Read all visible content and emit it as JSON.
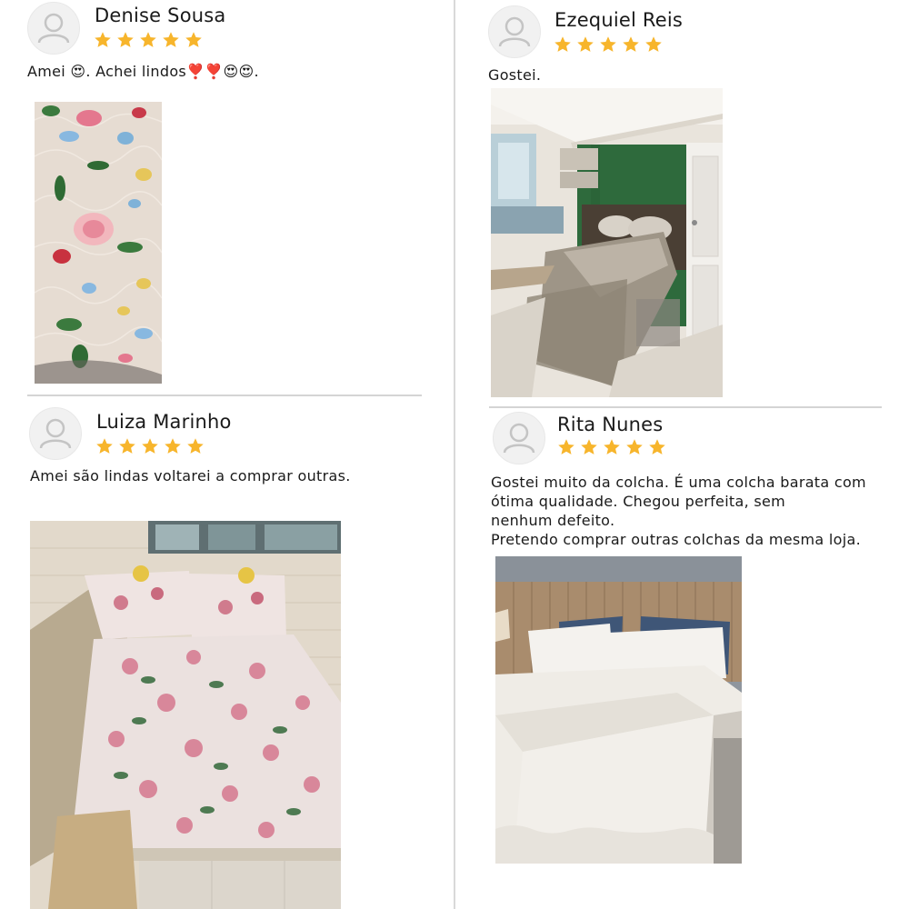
{
  "reviews": [
    {
      "name": "Denise Sousa",
      "rating": 5,
      "text": "Amei 😍. Achei lindos❣️❣️😍😍.",
      "photo": "floral-quilt-closeup-photo"
    },
    {
      "name": "Ezequiel Reis",
      "rating": 5,
      "text": "Gostei.",
      "photo": "bedroom-green-wall-photo"
    },
    {
      "name": "Luiza Marinho",
      "rating": 5,
      "text": "Amei são lindas voltarei a comprar outras.",
      "photo": "floral-bedspread-photo"
    },
    {
      "name": "Rita Nunes",
      "rating": 5,
      "text": "Gostei muito da colcha. É uma colcha barata com\nótima qualidade. Chegou perfeita, sem\nnenhum defeito.\nPretendo comprar outras colchas da mesma loja.",
      "photo": "white-bedspread-photo"
    }
  ],
  "colors": {
    "star": "#f7b52c",
    "divider": "#d4d4d4",
    "avatar_bg": "#f1f1f1",
    "avatar_icon": "#c4c4c4"
  },
  "icons": [
    "user-avatar-icon",
    "star-icon"
  ]
}
